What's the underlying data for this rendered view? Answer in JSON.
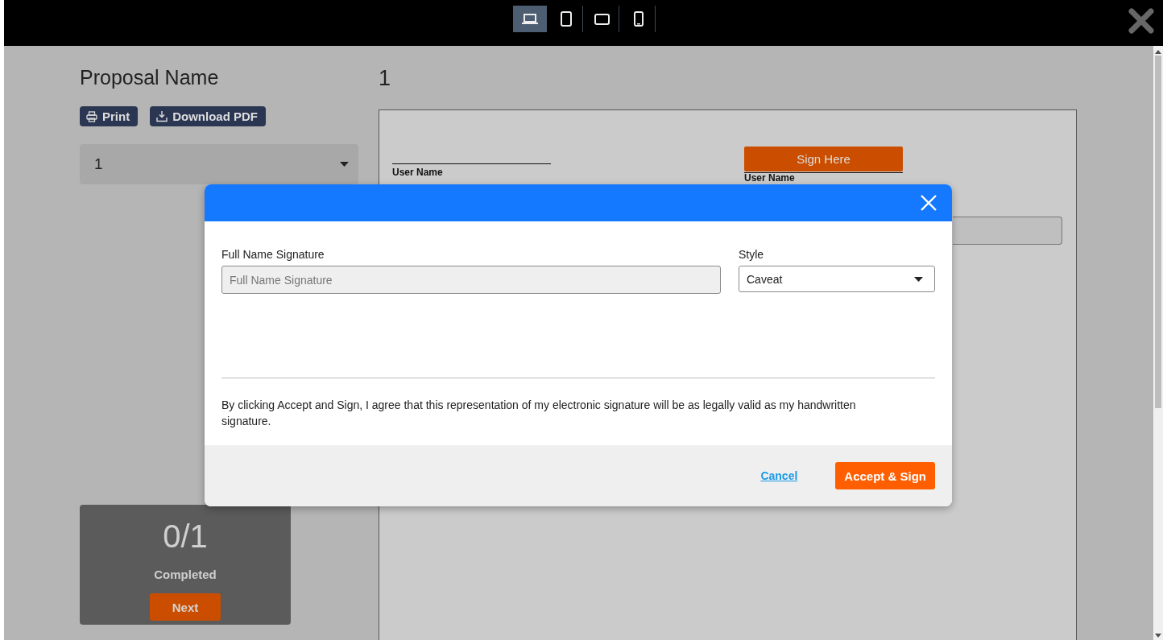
{
  "device_bar": {
    "devices": [
      {
        "kind": "laptop",
        "selected": true
      },
      {
        "kind": "tablet",
        "selected": false
      },
      {
        "kind": "tablet-landscape",
        "selected": false
      },
      {
        "kind": "phone",
        "selected": false
      }
    ]
  },
  "sidebar": {
    "title": "Proposal Name",
    "buttons": [
      {
        "kind": "print",
        "label": "Print"
      },
      {
        "kind": "download",
        "label": "Download PDF"
      }
    ],
    "page_select": {
      "value": "1"
    },
    "progress": {
      "count": "0/1",
      "label": "Completed",
      "button": "Next"
    }
  },
  "document": {
    "page_title": "1",
    "signature_line_label": "User Name",
    "sign_here": {
      "button": "Sign Here",
      "label": "User Name"
    }
  },
  "modal": {
    "name_label": "Full Name Signature",
    "name_placeholder": "Full Name Signature",
    "style_label": "Style",
    "style_value": "Caveat",
    "consent": "By clicking Accept and Sign, I agree that this representation of my electronic signature will be as legally valid as my handwritten signature.",
    "cancel": "Cancel",
    "accept": "Accept & Sign"
  }
}
